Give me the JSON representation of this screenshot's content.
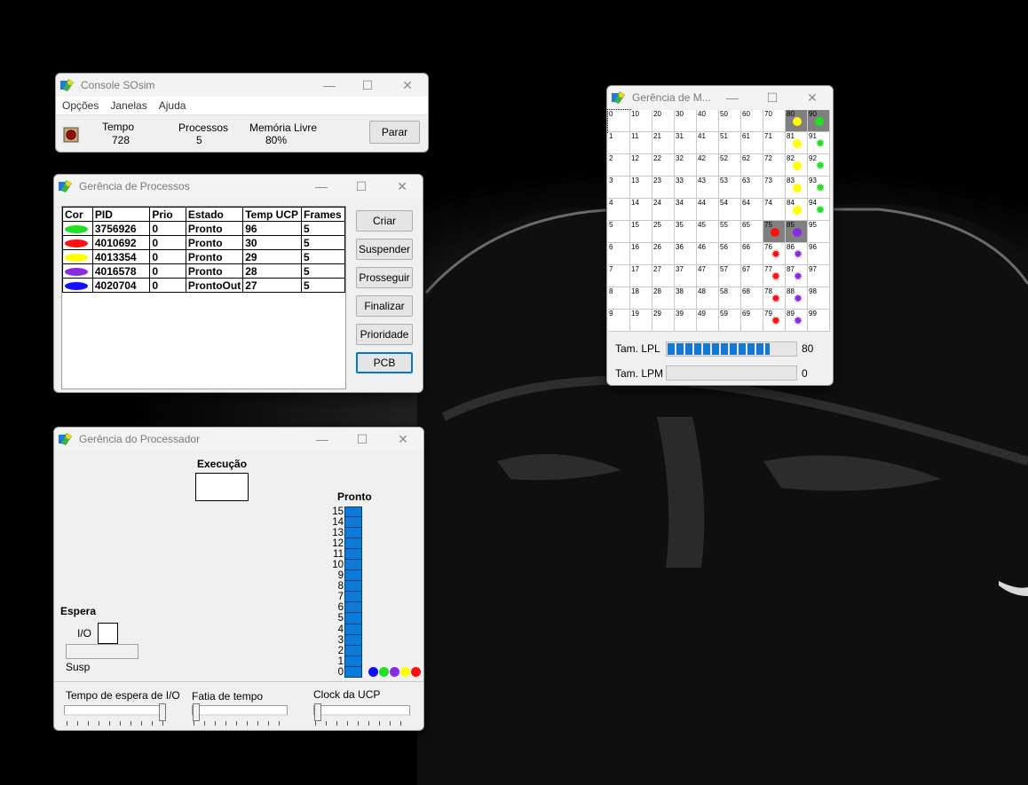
{
  "colors": {
    "ready_blue": "#0a7bd8",
    "lpl_blue": "#1778d3"
  },
  "console": {
    "title": "Console SOsim",
    "menu": [
      "Opções",
      "Janelas",
      "Ajuda"
    ],
    "tempo_label": "Tempo",
    "tempo_value": "728",
    "processos_label": "Processos",
    "processos_value": "5",
    "memoria_label": "Memória Livre",
    "memoria_value": "80%",
    "parar_label": "Parar",
    "status_icon": "record-icon"
  },
  "processos": {
    "title": "Gerência de Processos",
    "columns": [
      "Cor",
      "PID",
      "Prio",
      "Estado",
      "Temp UCP",
      "Frames"
    ],
    "rows": [
      {
        "color": "#22e022",
        "pid": "3756926",
        "prio": "0",
        "estado": "Pronto",
        "temp": "96",
        "frames": "5"
      },
      {
        "color": "#ff1010",
        "pid": "4010692",
        "prio": "0",
        "estado": "Pronto",
        "temp": "30",
        "frames": "5"
      },
      {
        "color": "#ffff00",
        "pid": "4013354",
        "prio": "0",
        "estado": "Pronto",
        "temp": "29",
        "frames": "5"
      },
      {
        "color": "#8a2be2",
        "pid": "4016578",
        "prio": "0",
        "estado": "Pronto",
        "temp": "28",
        "frames": "5"
      },
      {
        "color": "#1010ff",
        "pid": "4020704",
        "prio": "0",
        "estado": "ProntoOut",
        "temp": "27",
        "frames": "5"
      }
    ],
    "buttons": [
      "Criar",
      "Suspender",
      "Prosseguir",
      "Finalizar",
      "Prioridade",
      "PCB"
    ]
  },
  "processador": {
    "title": "Gerência do Processador",
    "execucao_label": "Execução",
    "pronto_label": "Pronto",
    "queue_levels": [
      "15",
      "14",
      "13",
      "12",
      "11",
      "10",
      "9",
      "8",
      "7",
      "6",
      "5",
      "4",
      "3",
      "2",
      "1",
      "0"
    ],
    "queue_dots": [
      "#1010ff",
      "#22e022",
      "#8a2be2",
      "#ffff00",
      "#ff1010"
    ],
    "espera_label": "Espera",
    "io_label": "I/O",
    "susp_label": "Susp",
    "tempo_io_label": "Tempo de espera de I/O",
    "fatia_label": "Fatia de tempo",
    "clock_label": "Clock da UCP"
  },
  "memoria": {
    "title": "Gerência de M...",
    "cells": [
      "0",
      "10",
      "20",
      "30",
      "40",
      "50",
      "60",
      "70",
      "80",
      "90",
      "1",
      "11",
      "21",
      "31",
      "41",
      "51",
      "61",
      "71",
      "81",
      "91",
      "2",
      "12",
      "22",
      "32",
      "42",
      "52",
      "62",
      "72",
      "82",
      "92",
      "3",
      "13",
      "23",
      "33",
      "43",
      "53",
      "63",
      "73",
      "83",
      "93",
      "4",
      "14",
      "24",
      "34",
      "44",
      "54",
      "64",
      "74",
      "84",
      "94",
      "5",
      "15",
      "25",
      "35",
      "45",
      "55",
      "65",
      "75",
      "85",
      "95",
      "6",
      "16",
      "26",
      "36",
      "46",
      "56",
      "66",
      "76",
      "86",
      "96",
      "7",
      "17",
      "27",
      "37",
      "47",
      "57",
      "67",
      "77",
      "87",
      "97",
      "8",
      "18",
      "28",
      "38",
      "48",
      "58",
      "68",
      "78",
      "88",
      "98",
      "9",
      "19",
      "29",
      "39",
      "49",
      "59",
      "69",
      "79",
      "89",
      "99"
    ],
    "busy_cells": [
      "80",
      "90",
      "75",
      "85"
    ],
    "markers": [
      {
        "cell": "80",
        "color": "#ffff00",
        "shape": "dot"
      },
      {
        "cell": "81",
        "color": "#ffff00",
        "shape": "dot"
      },
      {
        "cell": "82",
        "color": "#ffff00",
        "shape": "dot"
      },
      {
        "cell": "83",
        "color": "#ffff00",
        "shape": "dot"
      },
      {
        "cell": "84",
        "color": "#ffff00",
        "shape": "dot"
      },
      {
        "cell": "90",
        "color": "#22e022",
        "shape": "dot"
      },
      {
        "cell": "91",
        "color": "#22e022",
        "shape": "star"
      },
      {
        "cell": "92",
        "color": "#22e022",
        "shape": "star"
      },
      {
        "cell": "93",
        "color": "#22e022",
        "shape": "star"
      },
      {
        "cell": "94",
        "color": "#22e022",
        "shape": "star"
      },
      {
        "cell": "75",
        "color": "#ff1010",
        "shape": "dot"
      },
      {
        "cell": "76",
        "color": "#ff1010",
        "shape": "star"
      },
      {
        "cell": "77",
        "color": "#ff1010",
        "shape": "star"
      },
      {
        "cell": "78",
        "color": "#ff1010",
        "shape": "star"
      },
      {
        "cell": "79",
        "color": "#ff1010",
        "shape": "star"
      },
      {
        "cell": "85",
        "color": "#8a2be2",
        "shape": "dot"
      },
      {
        "cell": "86",
        "color": "#8a2be2",
        "shape": "star"
      },
      {
        "cell": "87",
        "color": "#8a2be2",
        "shape": "star"
      },
      {
        "cell": "88",
        "color": "#8a2be2",
        "shape": "star"
      },
      {
        "cell": "89",
        "color": "#8a2be2",
        "shape": "star"
      }
    ],
    "lpl_label": "Tam. LPL",
    "lpl_value": "80",
    "lpl_fill_fraction": 0.8,
    "lpm_label": "Tam. LPM",
    "lpm_value": "0",
    "lpm_fill_fraction": 0
  }
}
